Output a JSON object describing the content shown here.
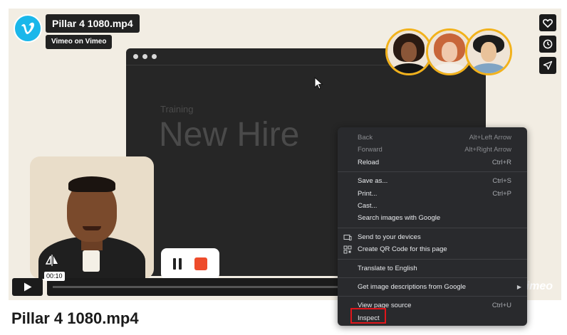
{
  "video": {
    "title": "Pillar 4 1080.mp4",
    "byline": "Vimeo on Vimeo",
    "scene_small": "Training",
    "scene_big": "New Hire",
    "time": "00:10",
    "brand": "vimeo"
  },
  "icons": {
    "logo": "vimeo-logo-icon",
    "like": "heart-icon",
    "later": "clock-icon",
    "share": "paper-plane-icon",
    "play": "play-icon",
    "flip": "flip-icon"
  },
  "page": {
    "heading": "Pillar 4 1080.mp4"
  },
  "context_menu": {
    "items": [
      {
        "label": "Back",
        "shortcut": "Alt+Left Arrow"
      },
      {
        "label": "Forward",
        "shortcut": "Alt+Right Arrow"
      },
      {
        "label": "Reload",
        "shortcut": "Ctrl+R"
      },
      {
        "label": "Save as...",
        "shortcut": "Ctrl+S"
      },
      {
        "label": "Print...",
        "shortcut": "Ctrl+P"
      },
      {
        "label": "Cast...",
        "shortcut": ""
      },
      {
        "label": "Search images with Google",
        "shortcut": ""
      },
      {
        "label": "Send to your devices",
        "shortcut": ""
      },
      {
        "label": "Create QR Code for this page",
        "shortcut": ""
      },
      {
        "label": "Translate to English",
        "shortcut": ""
      },
      {
        "label": "Get image descriptions from Google",
        "shortcut": ""
      },
      {
        "label": "View page source",
        "shortcut": "Ctrl+U"
      },
      {
        "label": "Inspect",
        "shortcut": ""
      }
    ]
  },
  "colors": {
    "vimeo_blue": "#1ab7ea",
    "avatar_ring": "#f2b21c",
    "record_red": "#ee4b2b",
    "highlight_red": "#e0161b",
    "menu_bg": "#292a2d"
  }
}
